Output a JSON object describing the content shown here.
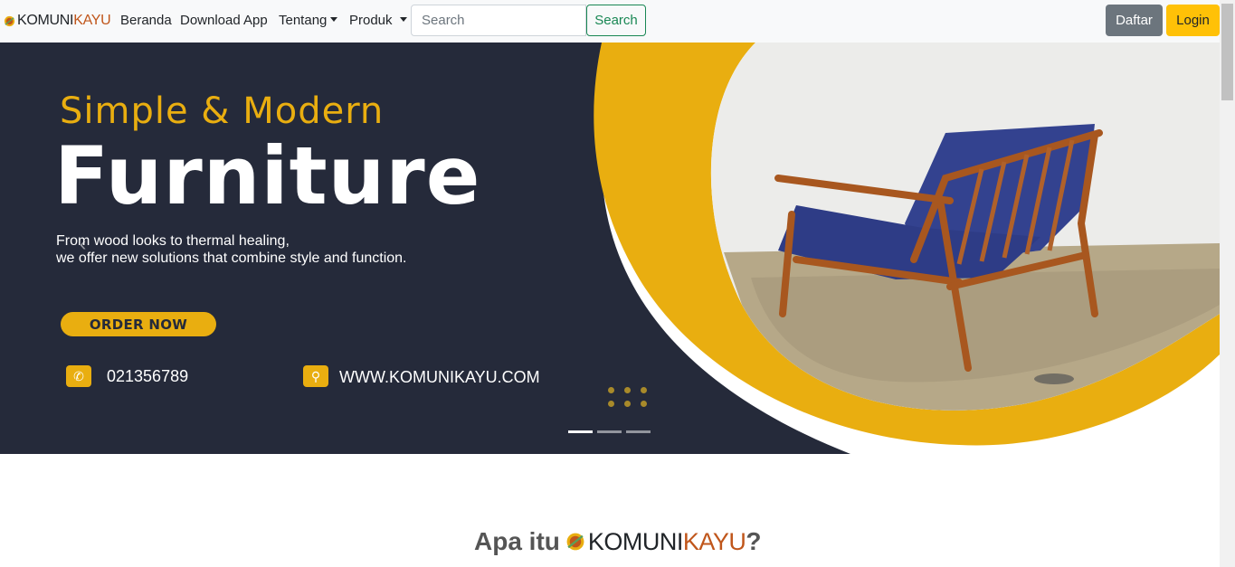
{
  "navbar": {
    "brand_part1": "KOMUNI",
    "brand_part2": "KAYU",
    "links": {
      "home": "Beranda",
      "download": "Download App",
      "about": "Tentang",
      "products": "Produk"
    },
    "search": {
      "placeholder": "Search",
      "value": "",
      "button_label": "Search"
    },
    "register_label": "Daftar",
    "login_label": "Login"
  },
  "hero": {
    "subtitle": "Simple & Modern",
    "title": "Furniture",
    "description_line1": "From wood looks to thermal healing,",
    "description_line2": "we offer new solutions that combine style and function.",
    "order_button": "ORDER NOW",
    "phone": "021356789",
    "website": "WWW.KOMUNIKAYU.COM",
    "slide_count": 3,
    "active_slide": 1
  },
  "section": {
    "title_prefix": "Apa itu",
    "brand_part1": "KOMUNI",
    "brand_part2": "KAYU",
    "title_suffix": "?"
  },
  "colors": {
    "accent_yellow": "#e9ae10",
    "hero_dark": "#252a3a",
    "brand_orange": "#c0561b",
    "search_green": "#198754",
    "login_yellow": "#ffc107",
    "daftar_gray": "#6c757d"
  },
  "icons": [
    "logo-icon",
    "caret-down-icon",
    "phone-icon",
    "link-icon",
    "chevron-left-icon"
  ]
}
